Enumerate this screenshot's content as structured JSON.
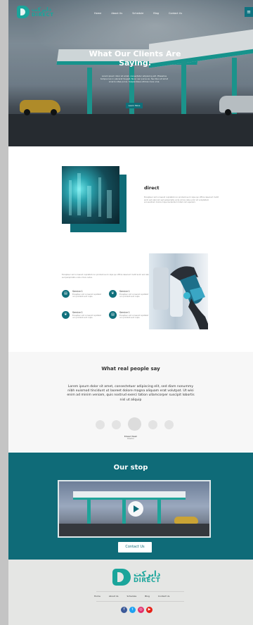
{
  "brand": {
    "name_ar": "دايركت",
    "name_en": "DIRECT"
  },
  "nav": {
    "items": [
      "Home",
      "About Us",
      "Schedule",
      "Blog",
      "Contact Us"
    ],
    "menu_icon": "hamburger-icon"
  },
  "hero": {
    "title": "What Our Clients Are Saying.",
    "text": "Lorem ipsum dolor sit amet, consectetur adipiscing elit. Phasellus tempus leo in placerat feugiat. Nunc nec purus ex, faucibus sit amet viverra vitae purus. Suspendisse ultrices risus urna.",
    "button": "Learn More"
  },
  "about": {
    "title": "direct",
    "text": "Excepteur sint occaecat cupidatat non proident sunt culpa qui officia deserunt mollit anim est, laborum sed perspiciatis unde omnis natus error sit voluptatem accusantium dolore mque laudantium totam rem aperiam."
  },
  "services": {
    "intro": "Excepteur sint occaecat cupidatat non proident sunt culpa qui officia deserunt mollit anim est, laborum sed perspiciatis unde omnis natus.",
    "items": [
      {
        "name": "Service 1",
        "desc": "Excepteur sint occaecat cupidatat non proident sunt culpa",
        "icon": "document-icon"
      },
      {
        "name": "Service 1",
        "desc": "Excepteur sint occaecat cupidatat non proident sunt culpa",
        "icon": "leaf-icon"
      },
      {
        "name": "Service 1",
        "desc": "Excepteur sint occaecat cupidatat non proident sunt culpa",
        "icon": "leaf-icon"
      },
      {
        "name": "Service 1",
        "desc": "Excepteur sint occaecat cupidatat non proident sunt culpa",
        "icon": "document-icon"
      }
    ]
  },
  "testimonials": {
    "title": "What real people say",
    "quote": "Lorem ipsum dolor sit amet, consectetuer adipiscing elit, sed diam nonummy nibh euismod tincidunt ut laoreet dolore magna aliquam erat volutpat. Ut wisi enim ad minim veniam, quis nostrud exerci tation ullamcorper suscipit lobortis nisl ut aliquip",
    "name": "Edward Nash",
    "role": "Director"
  },
  "stop": {
    "title": "Our stop",
    "button": "Contact Us"
  },
  "footer": {
    "nav": [
      "Home",
      "About Us",
      "Schedule",
      "Blog",
      "Contact Us"
    ],
    "social": [
      {
        "icon": "facebook-icon",
        "glyph": "f",
        "color": "#3b5998"
      },
      {
        "icon": "twitter-icon",
        "glyph": "t",
        "color": "#1da1f2"
      },
      {
        "icon": "instagram-icon",
        "glyph": "◎",
        "color": "#e1306c"
      },
      {
        "icon": "youtube-icon",
        "glyph": "▶",
        "color": "#e62117"
      }
    ]
  },
  "colors": {
    "teal": "#0f6b78",
    "brand": "#1aa59b"
  }
}
